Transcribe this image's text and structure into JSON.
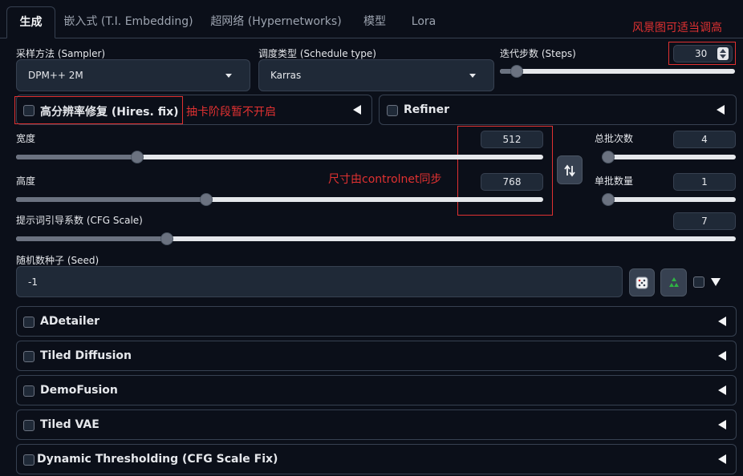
{
  "tabs": [
    {
      "label": "生成",
      "active": true
    },
    {
      "label": "嵌入式 (T.I. Embedding)",
      "active": false
    },
    {
      "label": "超网络 (Hypernetworks)",
      "active": false
    },
    {
      "label": "模型",
      "active": false
    },
    {
      "label": "Lora",
      "active": false
    }
  ],
  "sampler": {
    "label": "采样方法 (Sampler)",
    "value": "DPM++ 2M"
  },
  "schedule": {
    "label": "调度类型 (Schedule type)",
    "value": "Karras"
  },
  "steps": {
    "label": "迭代步数 (Steps)",
    "value": "30",
    "fraction": 0.07
  },
  "hires": {
    "label": "高分辨率修复 (Hires. fix)"
  },
  "refiner": {
    "label": "Refiner"
  },
  "width": {
    "label": "宽度",
    "value": "512",
    "fraction": 0.23
  },
  "height": {
    "label": "高度",
    "value": "768",
    "fraction": 0.36
  },
  "batch_count": {
    "label": "总批次数",
    "value": "4",
    "fraction": 0.0
  },
  "batch_size": {
    "label": "单批数量",
    "value": "1",
    "fraction": 0.0
  },
  "cfg": {
    "label": "提示词引导系数 (CFG Scale)",
    "value": "7",
    "fraction": 0.21
  },
  "seed": {
    "label": "随机数种子 (Seed)",
    "value": "-1"
  },
  "extensions": [
    {
      "label": "ADetailer"
    },
    {
      "label": "Tiled Diffusion"
    },
    {
      "label": "DemoFusion"
    },
    {
      "label": "Tiled VAE"
    },
    {
      "label": "Dynamic Thresholding (CFG Scale Fix)"
    }
  ],
  "annotations": {
    "landscape": "风景图可适当调高",
    "hires_note": "抽卡阶段暂不开启",
    "size_note": "尺寸由controlnet同步"
  },
  "colors": {
    "accent": "#e03131",
    "background": "#0b0f19",
    "panel": "#1f2937",
    "slider_fill": "#6b7280"
  },
  "icons": [
    "swap-icon",
    "dice-icon",
    "recycle-icon",
    "collapse-triangle-icon",
    "spinner-arrows-icon"
  ]
}
